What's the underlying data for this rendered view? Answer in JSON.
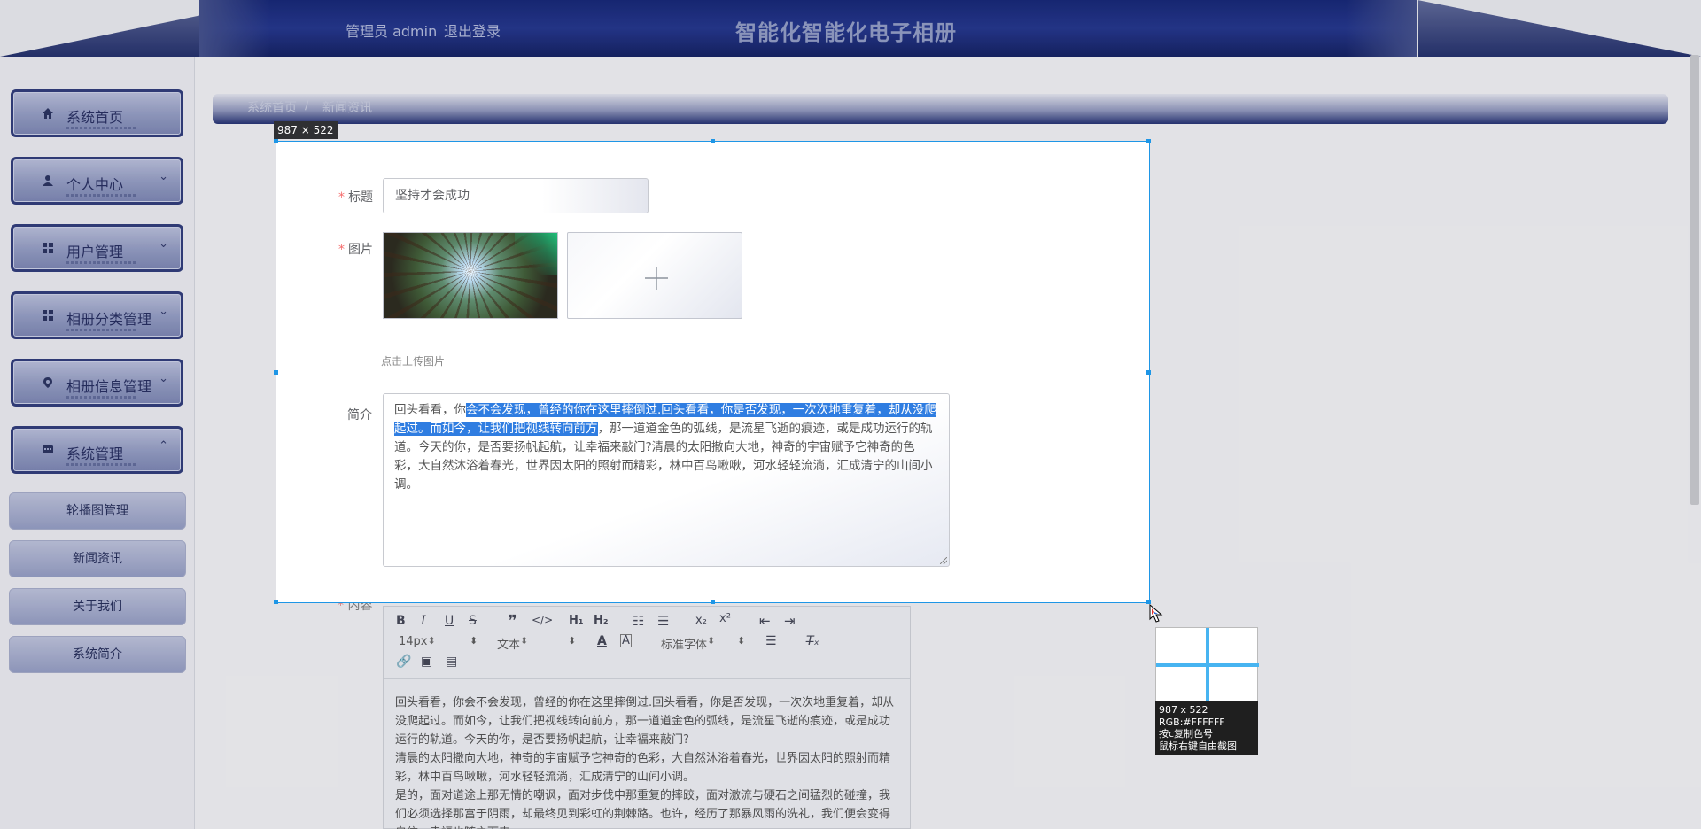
{
  "header": {
    "admin_label": "管理员 admin",
    "logout_label": "退出登录",
    "app_title": "智能化智能化电子相册"
  },
  "sidebar": {
    "items": [
      {
        "label": "系统首页",
        "icon": "home-icon",
        "arrow": ""
      },
      {
        "label": "个人中心",
        "icon": "user-icon",
        "arrow": "⌄"
      },
      {
        "label": "用户管理",
        "icon": "grid-icon",
        "arrow": "⌄"
      },
      {
        "label": "相册分类管理",
        "icon": "grid-icon",
        "arrow": "⌄"
      },
      {
        "label": "相册信息管理",
        "icon": "pin-icon",
        "arrow": "⌄"
      },
      {
        "label": "系统管理",
        "icon": "chat-icon",
        "arrow": "⌃"
      }
    ],
    "sub_items": [
      "轮播图管理",
      "新闻资讯",
      "关于我们",
      "系统简介"
    ]
  },
  "breadcrumb": {
    "home": "系统首页",
    "separator": "/",
    "current": "新闻资讯"
  },
  "form": {
    "title_label": "标题",
    "title_value": "坚持才会成功",
    "image_label": "图片",
    "upload_hint": "点击上传图片",
    "intro_label": "简介",
    "intro_before": "回头看看，你",
    "intro_highlight_1": "会不会发现，曾经的你在这里摔倒过.回头看看，你是否发现，一次次地重复着，却从",
    "intro_highlight_2": "没爬起过。而如今，让我们把视线转向前方",
    "intro_after": "，那一道道金色的弧线，是流星飞逝的痕迹，或是成功运行的轨道。今天的你，是否要扬帆起航，让幸福来敲门?清晨的太阳撒向大地，神奇的宇宙赋予它神奇的色彩，大自然沐浴着春光，世界因太阳的照射而精彩，林中百鸟啾啾，河水轻轻流淌，汇成清宁的山间小调。",
    "content_label": "内容"
  },
  "editor": {
    "font_size": "14px",
    "block_type": "文本",
    "font_family": "标准字体",
    "paragraphs": [
      "回头看看，你会不会发现，曾经的你在这里摔倒过.回头看看，你是否发现，一次次地重复着，却从没爬起过。而如今，让我们把视线转向前方，那一道道金色的弧线，是流星飞逝的痕迹，或是成功运行的轨道。今天的你，是否要扬帆起航，让幸福来敲门?",
      "清晨的太阳撒向大地，神奇的宇宙赋予它神奇的色彩，大自然沐浴着春光，世界因太阳的照射而精彩，林中百鸟啾啾，河水轻轻流淌，汇成清宁的山间小调。",
      "是的，面对道途上那无情的嘲讽，面对步伐中那重复的摔跤，面对激流与硬石之间猛烈的碰撞，我们必须选择那富于阴雨，却最终见到彩虹的荆棘路。也许，经历了那暴风雨的洗礼，我们便会变得自信，幸福也随之而来。"
    ]
  },
  "capture": {
    "size_label": "987 × 522",
    "magnifier_size": "987 x 522",
    "rgb": "RGB:#FFFFFF",
    "copy_hint": "按c复制色号",
    "right_click_hint": "鼠标右键自由截图",
    "selection_color": "#1e96e6"
  }
}
